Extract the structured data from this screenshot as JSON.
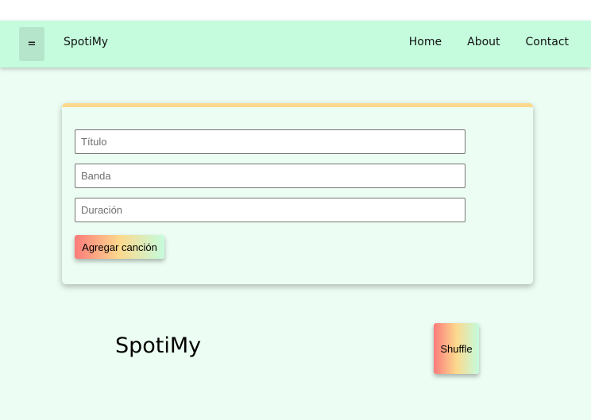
{
  "navbar": {
    "menu_label": "=",
    "brand": "SpotiMy",
    "links": [
      "Home",
      "About",
      "Contact"
    ]
  },
  "form": {
    "titulo_placeholder": "Título",
    "banda_placeholder": "Banda",
    "duracion_placeholder": "Duración",
    "submit_label": "Agregar canción"
  },
  "player": {
    "title": "SpotiMy",
    "shuffle_label": "Shuffle"
  },
  "colors": {
    "page_bg": "#ecfdf3",
    "navbar_bg": "#c4fcdd",
    "menu_button_bg": "#b5e6cb",
    "card_top_border": "#fcd98d",
    "gradient": [
      "#fb7b7b",
      "#fcd98d",
      "#c4fcdd"
    ]
  }
}
